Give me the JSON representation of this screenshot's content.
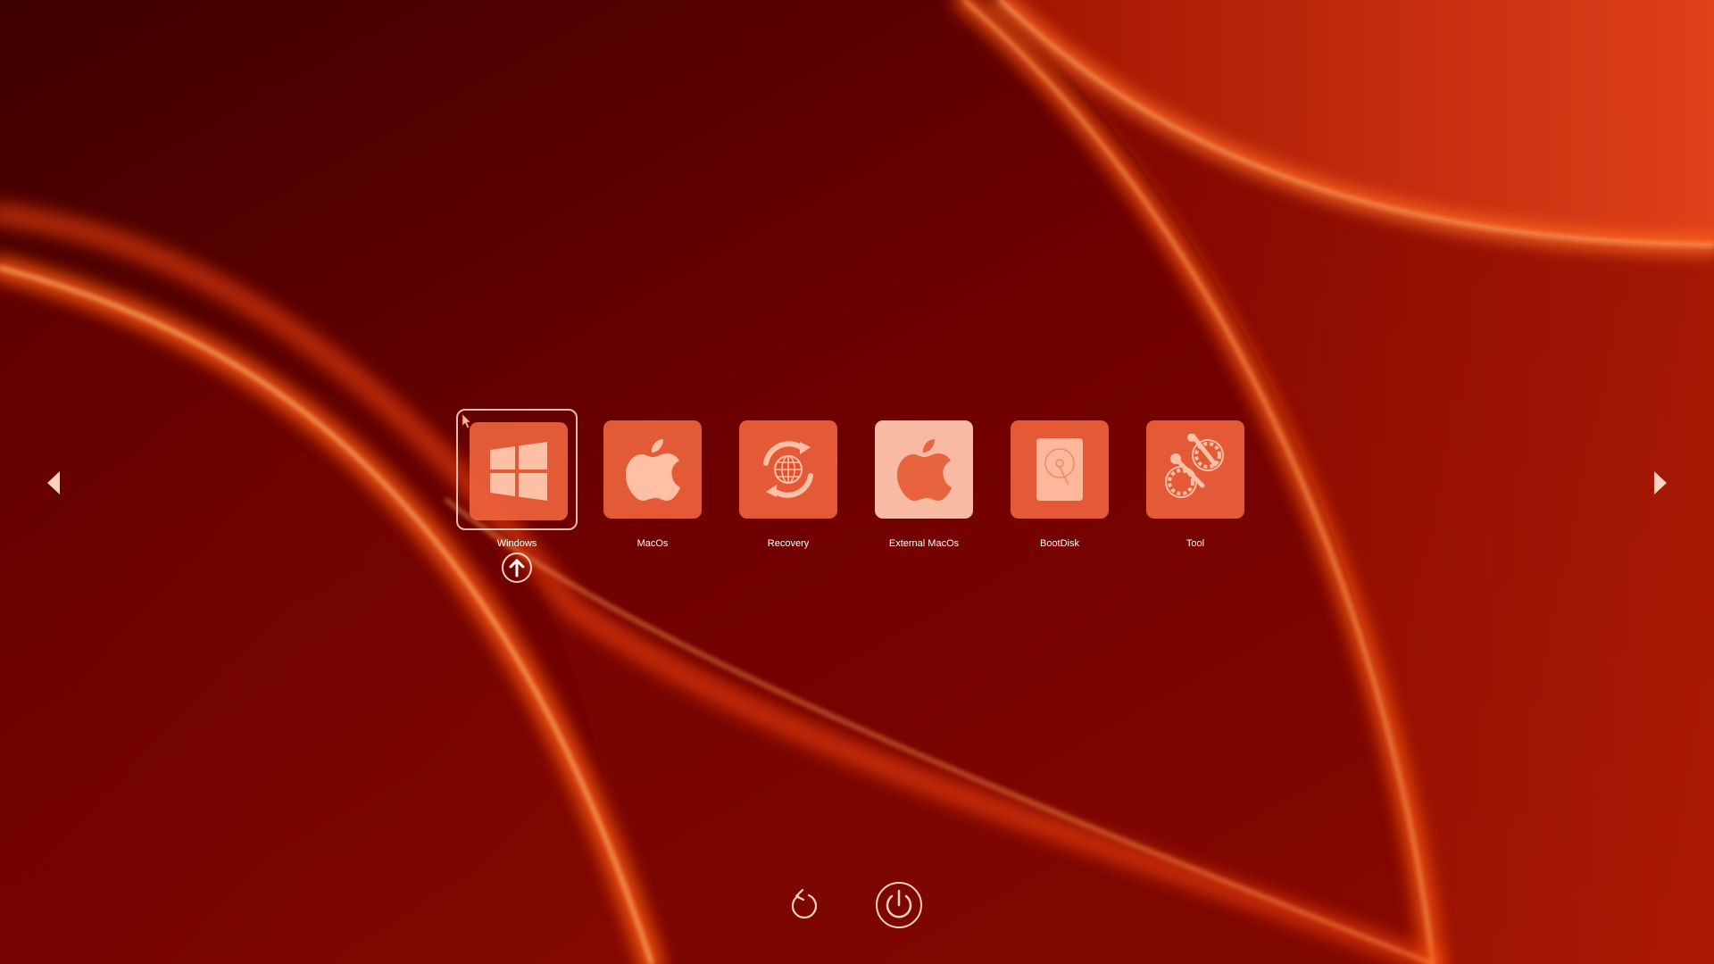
{
  "entries": [
    {
      "label": "Windows",
      "icon": "windows-logo-icon",
      "selected": true
    },
    {
      "label": "MacOs",
      "icon": "apple-logo-icon",
      "selected": false
    },
    {
      "label": "Recovery",
      "icon": "recovery-globe-icon",
      "selected": false
    },
    {
      "label": "External MacOs",
      "icon": "apple-logo-icon",
      "selected": false
    },
    {
      "label": "BootDisk",
      "icon": "disk-icon",
      "selected": false
    },
    {
      "label": "Tool",
      "icon": "tools-gears-icon",
      "selected": false
    }
  ],
  "icons": {
    "selected_badge": "arrow-up-circle-icon",
    "left": "chevron-left-icon",
    "right": "chevron-right-icon",
    "restart": "restart-icon",
    "shutdown": "power-icon",
    "cursor": "mouse-pointer-icon"
  },
  "colors": {
    "tile": "#ee623c",
    "tile_highlight": "#ffc4ac",
    "label": "#ffffff",
    "background_dark": "#4a0000",
    "background_bright": "#e04018"
  }
}
